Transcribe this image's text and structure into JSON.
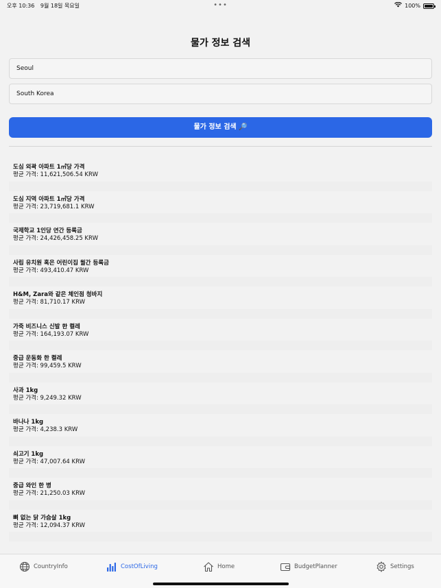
{
  "status_bar": {
    "time": "오후 10:36",
    "date": "9월 18일 목요일",
    "battery": "100%"
  },
  "page": {
    "title": "물가 정보 검색"
  },
  "form": {
    "city_value": "Seoul",
    "country_value": "South Korea",
    "search_label": "물가 정보 검색 🔎"
  },
  "results": [
    {
      "name": "도심 외곽 아파트 1㎡당 가격",
      "price": "평균 가격: 11,621,506.54 KRW"
    },
    {
      "name": "도심 지역 아파트 1㎡당 가격",
      "price": "평균 가격: 23,719,681.1 KRW"
    },
    {
      "name": "국제학교 1인당 연간 등록금",
      "price": "평균 가격: 24,426,458.25 KRW"
    },
    {
      "name": "사립 유치원 혹은 어린이집 월간 등록금",
      "price": "평균 가격: 493,410.47 KRW"
    },
    {
      "name": "H&M, Zara와 같은 체인점 청바지",
      "price": "평균 가격: 81,710.17 KRW"
    },
    {
      "name": "가죽 비즈니스 신발 한 켤레",
      "price": "평균 가격: 164,193.07 KRW"
    },
    {
      "name": "중급 운동화 한 켤레",
      "price": "평균 가격: 99,459.5 KRW"
    },
    {
      "name": "사과 1kg",
      "price": "평균 가격: 9,249.32 KRW"
    },
    {
      "name": "바나나 1kg",
      "price": "평균 가격: 4,238.3 KRW"
    },
    {
      "name": "쇠고기 1kg",
      "price": "평균 가격: 47,007.64 KRW"
    },
    {
      "name": "중급 와인 한 병",
      "price": "평균 가격: 21,250.03 KRW"
    },
    {
      "name": "뼈 없는 닭 가슴살 1kg",
      "price": "평균 가격: 12,094.37 KRW"
    },
    {
      "name": "",
      "price": ""
    }
  ],
  "tabs": [
    {
      "label": "CountryInfo",
      "icon": "globe-icon",
      "active": false
    },
    {
      "label": "CostOfLiving",
      "icon": "chart-icon",
      "active": true
    },
    {
      "label": "Home",
      "icon": "house-icon",
      "active": false
    },
    {
      "label": "BudgetPlanner",
      "icon": "wallet-icon",
      "active": false
    },
    {
      "label": "Settings",
      "icon": "gear-icon",
      "active": false
    }
  ],
  "colors": {
    "accent": "#2b67e6",
    "background": "#f2f2f2"
  }
}
